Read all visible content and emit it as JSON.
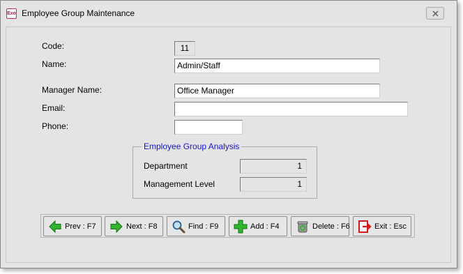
{
  "window": {
    "icon_text": "Exo",
    "title": "Employee Group Maintenance"
  },
  "form": {
    "code": {
      "label": "Code:",
      "value": "11"
    },
    "name": {
      "label": "Name:",
      "value": "Admin/Staff"
    },
    "manager_name": {
      "label": "Manager Name:",
      "value": "Office Manager"
    },
    "email": {
      "label": "Email:",
      "value": ""
    },
    "phone": {
      "label": "Phone:",
      "value": ""
    }
  },
  "analysis": {
    "title": "Employee Group Analysis",
    "department": {
      "label": "Department",
      "value": "1"
    },
    "management_level": {
      "label": "Management Level",
      "value": "1"
    }
  },
  "toolbar": {
    "prev": {
      "label": "Prev : F7",
      "icon": "left-arrow-icon"
    },
    "next": {
      "label": "Next : F8",
      "icon": "right-arrow-icon"
    },
    "find": {
      "label": "Find : F9",
      "icon": "magnifier-icon"
    },
    "add": {
      "label": "Add : F4",
      "icon": "plus-icon"
    },
    "delete": {
      "label": "Delete : F6",
      "icon": "trash-icon"
    },
    "exit": {
      "label": "Exit : Esc",
      "icon": "exit-icon"
    }
  },
  "colors": {
    "accent_blue": "#1616d0",
    "icon_green": "#2fb52f",
    "exit_red": "#d01818"
  }
}
